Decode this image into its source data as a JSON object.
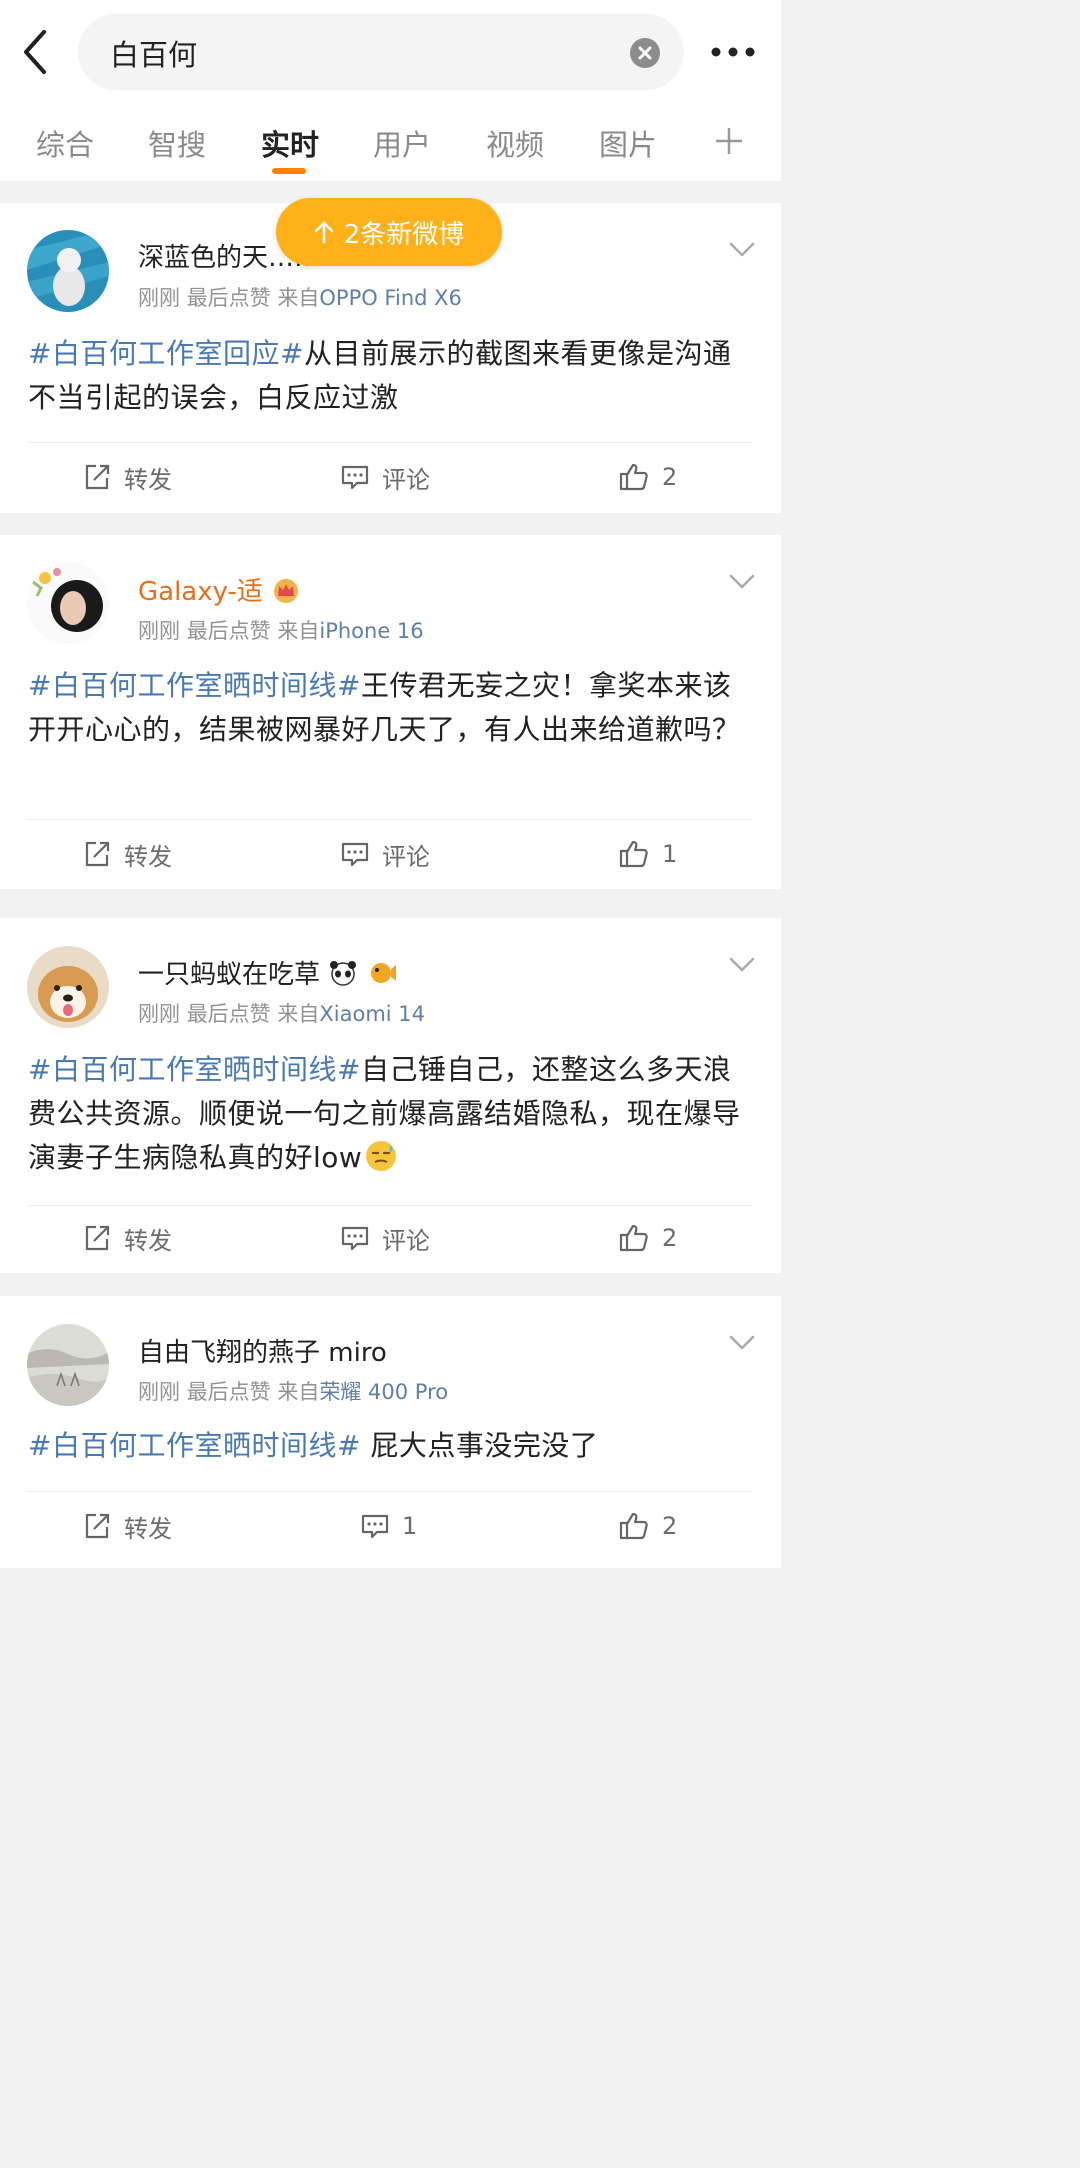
{
  "search": {
    "query": "白百何"
  },
  "tabs": [
    {
      "label": "综合"
    },
    {
      "label": "智搜"
    },
    {
      "label": "实时"
    },
    {
      "label": "用户"
    },
    {
      "label": "视频"
    },
    {
      "label": "图片"
    }
  ],
  "new_posts": {
    "label": "2条新微博"
  },
  "posts": [
    {
      "username": "深蓝色的天……",
      "time": "刚刚",
      "status": "最后点赞",
      "source_prefix": "来自",
      "device": "OPPO Find X6",
      "topic": "#白百何工作室回应#",
      "text": "从目前展示的截图来看更像是沟通不当引起的误会，白反应过激",
      "repost_label": "转发",
      "comment_label": "评论",
      "like_count": "2"
    },
    {
      "username": "Galaxy-适",
      "time": "刚刚",
      "status": "最后点赞",
      "source_prefix": "来自",
      "device": "iPhone 16",
      "topic": "#白百何工作室晒时间线#",
      "text": "王传君无妄之灾！拿奖本来该开开心心的，结果被网暴好几天了，有人出来给道歉吗？",
      "repost_label": "转发",
      "comment_label": "评论",
      "like_count": "1"
    },
    {
      "username": "一只蚂蚁在吃草",
      "time": "刚刚",
      "status": "最后点赞",
      "source_prefix": "来自",
      "device": "Xiaomi 14",
      "topic": "#白百何工作室晒时间线#",
      "text": "自己锤自己，还整这么多天浪费公共资源。顺便说一句之前爆高露结婚隐私，现在爆导演妻子生病隐私真的好low",
      "repost_label": "转发",
      "comment_label": "评论",
      "like_count": "2"
    },
    {
      "username": "自由飞翔的燕子 miro",
      "time": "刚刚",
      "status": "最后点赞",
      "source_prefix": "来自",
      "device": "荣耀 400 Pro",
      "topic": "#白百何工作室晒时间线#",
      "text": " 屁大点事没完没了",
      "repost_label": "转发",
      "comment_count": "1",
      "like_count": "2"
    }
  ]
}
